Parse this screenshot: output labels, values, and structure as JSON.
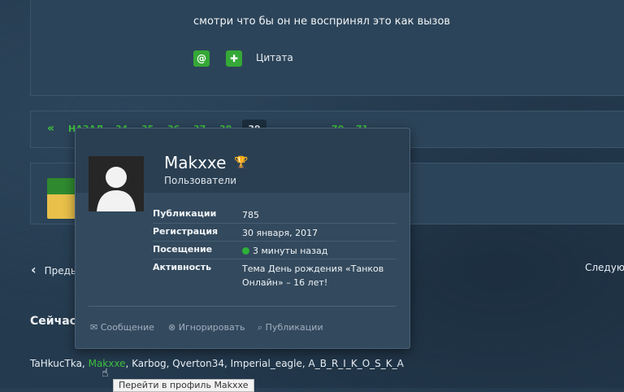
{
  "post": {
    "text": "смотри что бы он не воспринял это как вызов",
    "mention_icon": "at-icon",
    "plus_icon": "plus-icon",
    "quote_label": "Цитата"
  },
  "pagination": {
    "prev_label": "«",
    "first_label": "НАЗАД",
    "pages": [
      "34",
      "35",
      "36",
      "37",
      "38"
    ],
    "current": "39",
    "after": [
      "...",
      "70",
      "71 »"
    ]
  },
  "navigation": {
    "prev_label": "Предыдущая",
    "next_label": "Следующая"
  },
  "online": {
    "title": "Сейчас на странице",
    "users_before": "TaHkucTka, ",
    "highlighted_user": "Makxxe",
    "users_after": ", Karbog, Qverton34, Imperial_eagle, A_B_R_I_K_O_S_K_A"
  },
  "tooltip": {
    "text": "Перейти в профиль Makxxe"
  },
  "hovercard": {
    "name": "Makxxe",
    "group": "Пользователи",
    "stats": [
      {
        "label": "Публикации",
        "value": "785"
      },
      {
        "label": "Регистрация",
        "value": "30 января, 2017"
      },
      {
        "label": "Посещение",
        "value": "3 минуты назад"
      },
      {
        "label": "Активность",
        "value": "Тема День рождения «Танков Онлайн» – 16 лет!"
      }
    ],
    "actions": {
      "message": "Сообщение",
      "ignore": "Игнорировать",
      "posts": "Публикации"
    }
  }
}
